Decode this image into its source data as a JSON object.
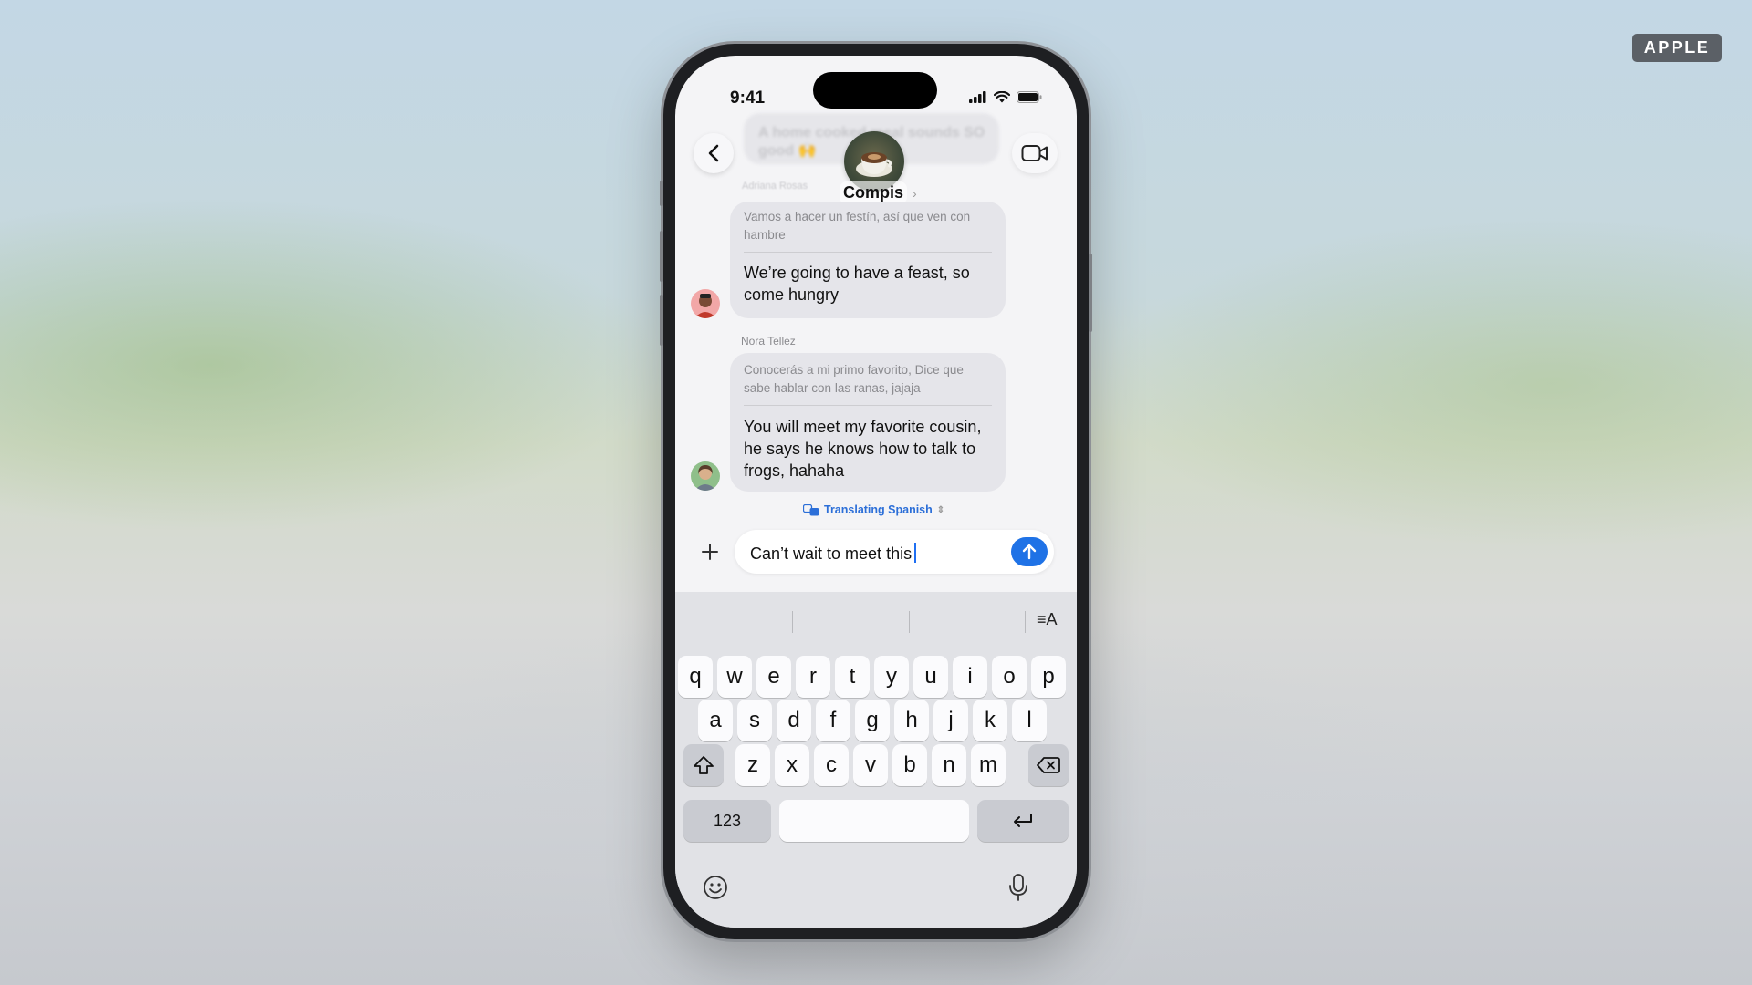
{
  "badge": "APPLE",
  "status_bar": {
    "time": "9:41"
  },
  "header": {
    "group_name": "Compis",
    "ghost_message": "A home cooked meal sounds SO good 🙌",
    "ghost_sender": "Adriana Rosas"
  },
  "messages": [
    {
      "sender": "",
      "original": [
        "Vamos a hacer un festín, así que ven con",
        "hambre"
      ],
      "translation": [
        "We’re going to have a feast, so",
        "come hungry"
      ]
    },
    {
      "sender": "Nora Tellez",
      "original": [
        "Conocerás a mi primo favorito, Dice que",
        "sabe hablar con las ranas, jajaja"
      ],
      "translation": [
        "You will meet my favorite cousin,",
        "he says he knows how to talk to",
        "frogs, hahaha"
      ]
    }
  ],
  "translating_label": "Translating Spanish",
  "compose": {
    "text": "Can’t wait to meet this"
  },
  "keyboard": {
    "row1": [
      "q",
      "w",
      "e",
      "r",
      "t",
      "y",
      "u",
      "i",
      "o",
      "p"
    ],
    "row2": [
      "a",
      "s",
      "d",
      "f",
      "g",
      "h",
      "j",
      "k",
      "l"
    ],
    "row3": [
      "z",
      "x",
      "c",
      "v",
      "b",
      "n",
      "m"
    ],
    "numbers_label": "123",
    "formatting_label": "≡A"
  },
  "colors": {
    "accent": "#1f72e6",
    "bubble": "#e5e5ea",
    "link": "#2c6fd8"
  },
  "icons": [
    "back-chevron-icon",
    "video-call-icon",
    "signal-icon",
    "wifi-icon",
    "battery-icon",
    "plus-icon",
    "send-arrow-icon",
    "shift-icon",
    "delete-icon",
    "return-icon",
    "emoji-icon",
    "microphone-icon",
    "translate-icon"
  ]
}
